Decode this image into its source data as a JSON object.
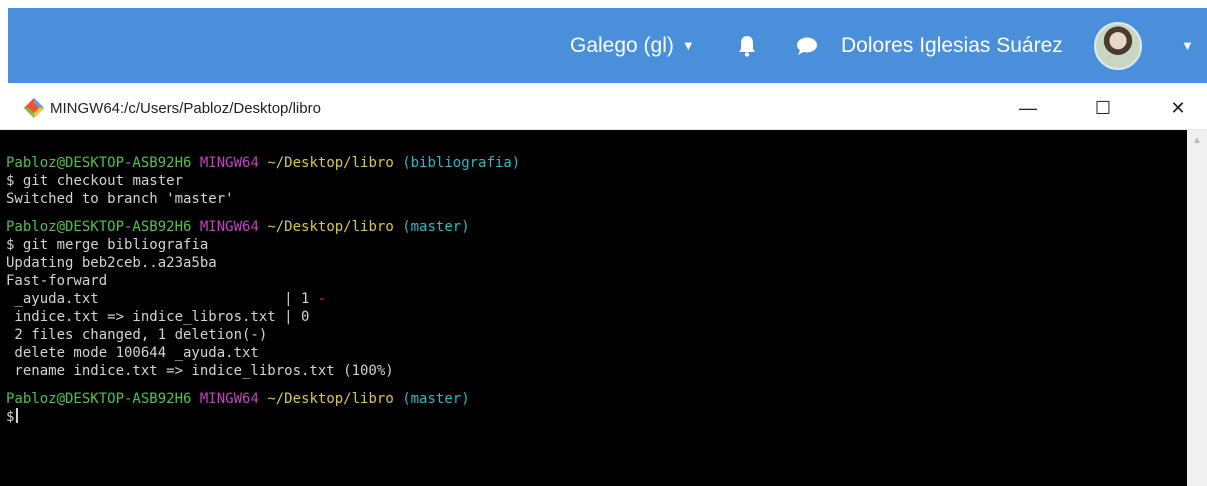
{
  "topbar": {
    "language": "Galego (gl)",
    "user_name": "Dolores Iglesias Suárez",
    "icons": [
      "caret-down-icon",
      "bell-icon",
      "chat-bubble-icon",
      "avatar",
      "caret-down-icon"
    ],
    "background_color": "#4a8fd9"
  },
  "window": {
    "title": "MINGW64:/c/Users/Pabloz/Desktop/libro",
    "icon": "git-icon",
    "minimize_label": "—",
    "maximize_label": "☐",
    "close_label": "✕"
  },
  "terminal": {
    "user_host": "Pabloz@DESKTOP-ASB92H6",
    "system": "MINGW64",
    "path": "~/Desktop/libro",
    "prompt_symbol": "$",
    "prompts": [
      {
        "branch": "(bibliografia)",
        "command": "git checkout master",
        "output": [
          "Switched to branch 'master'"
        ]
      },
      {
        "branch": "(master)",
        "command": "git merge bibliografia",
        "output": [
          "Updating beb2ceb..a23a5ba",
          "Fast-forward"
        ]
      },
      {
        "branch": "(master)",
        "command": "",
        "output": []
      }
    ],
    "diffstat": [
      {
        "file": " _ayuda.txt                      ",
        "sep": "| 1 ",
        "marks": "-"
      },
      {
        "file": " indice.txt => indice_libros.txt ",
        "sep": "| 0",
        "marks": ""
      }
    ],
    "summary": [
      " 2 files changed, 1 deletion(-)",
      " delete mode 100644 _ayuda.txt",
      " rename indice.txt => indice_libros.txt (100%)"
    ],
    "colors": {
      "user": "#4ec24e",
      "system": "#c243c2",
      "path": "#d6c94a",
      "branch": "#30b6c6",
      "deletion": "#dd3333"
    }
  }
}
